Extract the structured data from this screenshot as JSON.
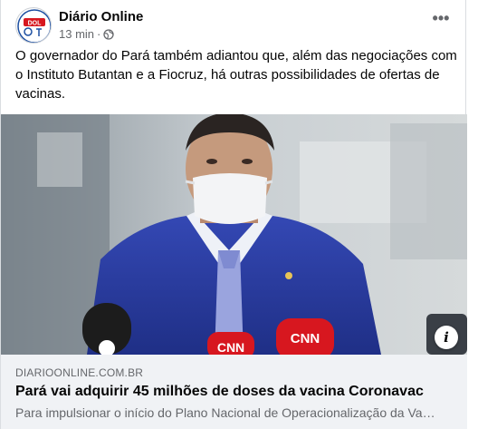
{
  "post": {
    "page_name": "Diário Online",
    "avatar_text": "DOL",
    "time": "13 min",
    "separator": "·",
    "privacy_icon": "globe-icon",
    "more_label": "•••",
    "text": "O governador do Pará também adiantou que, além das negociações com o Instituto Butantan e a Fiocruz, há outras possibilidades de ofertas de vacinas."
  },
  "photo": {
    "mic_logo_left": "CNN",
    "mic_logo_right": "CNN",
    "info_label": "i"
  },
  "link": {
    "domain": "DIARIOONLINE.COM.BR",
    "title": "Pará vai adquirir 45 milhões de doses da vacina Coronavac",
    "description": "Para impulsionar o início do Plano Nacional de Operacionalização da Vacinação"
  },
  "colors": {
    "brand_red": "#d7171f",
    "suit_blue": "#2b3fa8",
    "link_bg": "#f0f2f5"
  }
}
